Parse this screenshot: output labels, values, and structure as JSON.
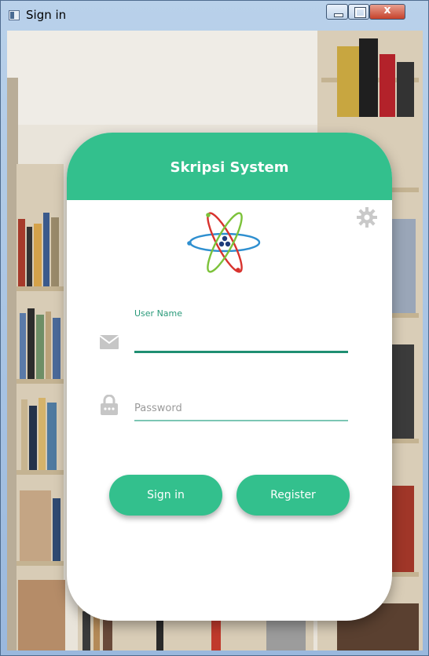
{
  "window": {
    "title": "Sign in",
    "close_glyph": "x",
    "controls": [
      "minimize",
      "maximize",
      "close"
    ]
  },
  "app": {
    "title": "Skripsi System",
    "settings_icon": "gear-icon",
    "logo_icon": "atom-icon"
  },
  "form": {
    "username_label": "User Name",
    "username_value": "",
    "username_icon": "envelope-icon",
    "password_placeholder": "Password",
    "password_value": "",
    "password_icon": "lock-icon"
  },
  "buttons": {
    "signin_label": "Sign in",
    "register_label": "Register"
  },
  "colors": {
    "accent": "#33c08d",
    "underline": "#1f8f72",
    "card": "#ffffff"
  }
}
